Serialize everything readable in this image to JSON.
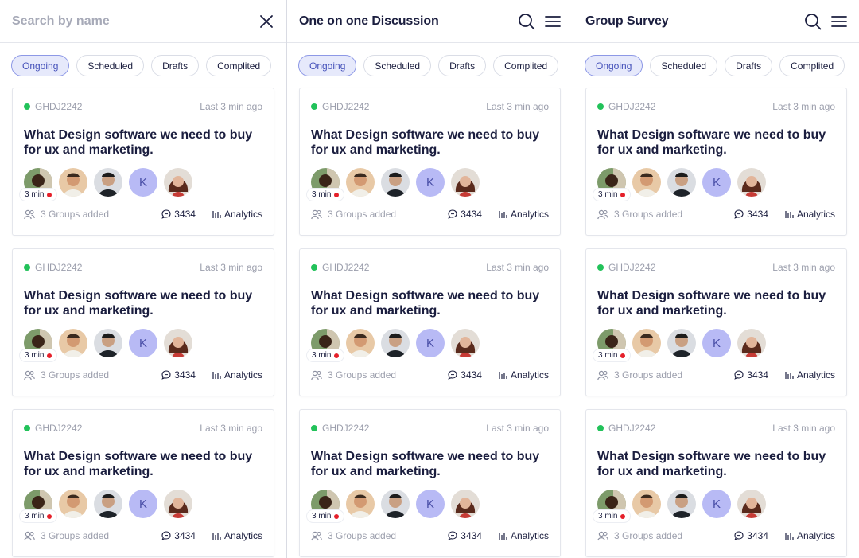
{
  "panels": [
    {
      "header": {
        "kind": "search",
        "placeholder": "Search by name",
        "close_icon": "close-icon"
      },
      "tabs": [
        "Ongoing",
        "Scheduled",
        "Drafts",
        "Complited"
      ],
      "active_tab": 0
    },
    {
      "header": {
        "kind": "title",
        "title": "One on one Discussion",
        "icons": [
          "search-icon",
          "menu-icon"
        ]
      },
      "tabs": [
        "Ongoing",
        "Scheduled",
        "Drafts",
        "Complited"
      ],
      "active_tab": 0
    },
    {
      "header": {
        "kind": "title",
        "title": "Group Survey",
        "icons": [
          "search-icon",
          "menu-icon"
        ]
      },
      "tabs": [
        "Ongoing",
        "Scheduled",
        "Drafts",
        "Complited"
      ],
      "active_tab": 0
    }
  ],
  "card": {
    "code": "GHDJ2242",
    "updated": "Last 3 min ago",
    "title": "What Design software we need to buy for ux and marketing.",
    "live_label": "3 min",
    "avatar_initial": "K",
    "groups": "3 Groups added",
    "comments": "3434",
    "analytics": "Analytics"
  },
  "cards_per_panel": 3,
  "colors": {
    "accent": "#4450b9",
    "active_tab_bg": "#e6e9fb",
    "status_green": "#22c25a",
    "live_red": "#e5202a",
    "avatar_k_bg": "#b8baf5"
  }
}
